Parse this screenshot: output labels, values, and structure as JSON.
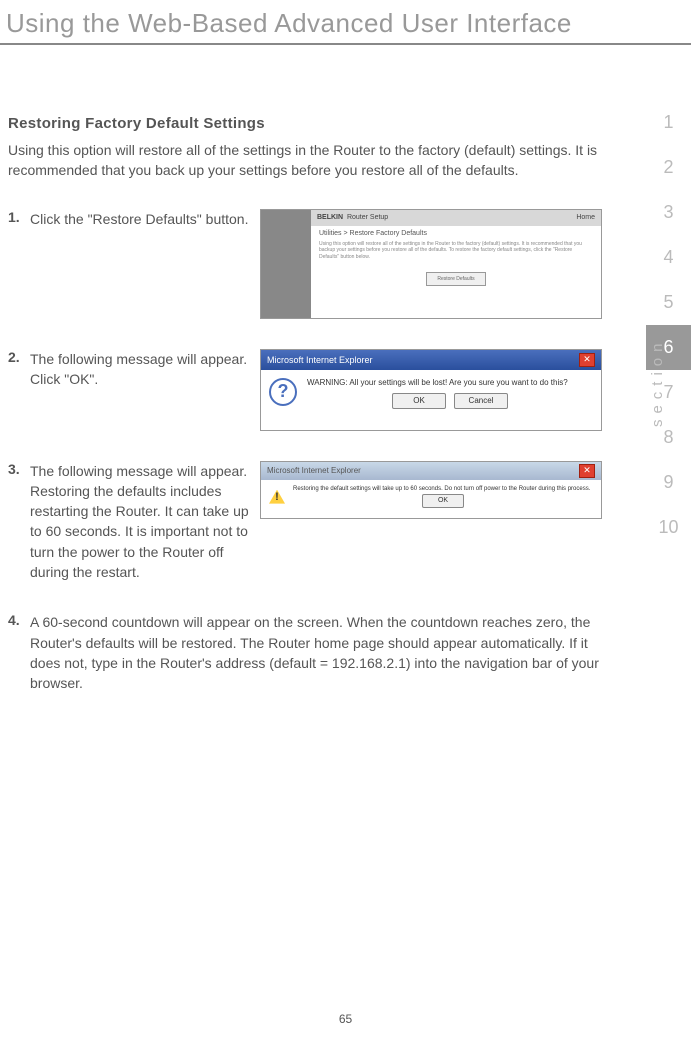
{
  "header": {
    "title": "Using the Web-Based Advanced User Interface"
  },
  "sectionLabel": "section",
  "nav": {
    "items": [
      "1",
      "2",
      "3",
      "4",
      "5",
      "6",
      "7",
      "8",
      "9",
      "10"
    ],
    "active": "6"
  },
  "main": {
    "subtitle": "Restoring Factory Default Settings",
    "intro": "Using this option will restore all of the settings in the Router to the factory (default) settings. It is recommended that you back up your settings before you restore all of the defaults."
  },
  "steps": [
    {
      "num": "1.",
      "text": "Click the \"Restore Defaults\" button."
    },
    {
      "num": "2.",
      "text": "The following message will appear. Click \"OK\"."
    },
    {
      "num": "3.",
      "text": "The following message will appear. Restoring the defaults includes restarting the Router. It can take up to 60 seconds. It is important not to turn the power to the Router off during the restart."
    },
    {
      "num": "4.",
      "text": "A 60-second countdown will appear on the screen. When the countdown reaches zero, the Router's defaults will be restored. The Router home page should appear automatically. If it does not, type in the Router's address (default = 192.168.2.1) into the navigation bar of your browser."
    }
  ],
  "screenshots": {
    "s1": {
      "brand": "BELKIN",
      "brandSub": "Router Setup",
      "home": "Home",
      "breadcrumb": "Utilities > Restore Factory Defaults",
      "desc": "Using this option will restore all of the settings in the Router to the factory (default) settings. It is recommended that you backup your settings before you restore all of the defaults. To restore the factory default settings, click the \"Restore Defaults\" button below.",
      "button": "Restore Defaults"
    },
    "s2": {
      "title": "Microsoft Internet Explorer",
      "msg": "WARNING: All your settings will be lost! Are you sure you want to do this?",
      "ok": "OK",
      "cancel": "Cancel"
    },
    "s3": {
      "title": "Microsoft Internet Explorer",
      "msg": "Restoring the default settings will take up to 60 seconds. Do not turn off power to the Router during this process.",
      "ok": "OK"
    }
  },
  "pageNumber": "65"
}
